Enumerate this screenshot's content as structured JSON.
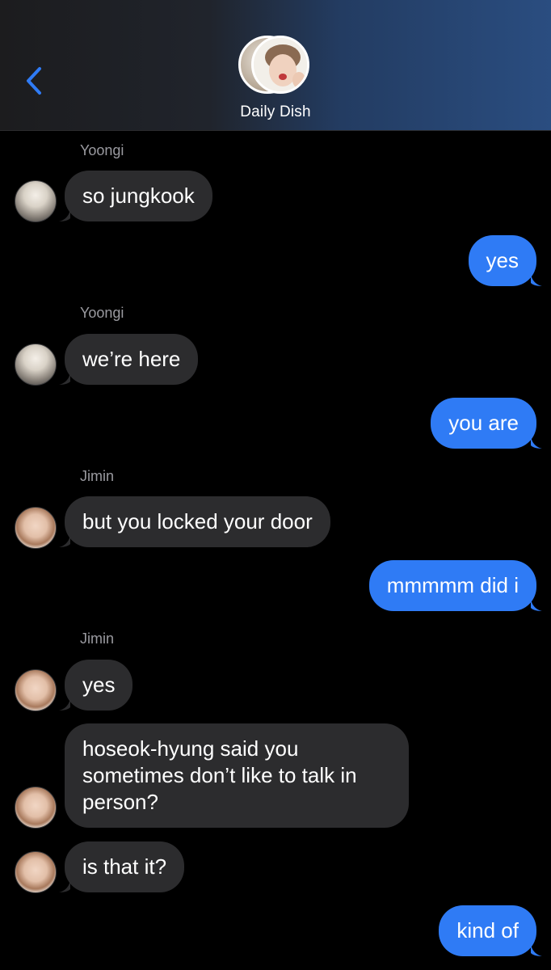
{
  "header": {
    "group_name": "Daily Dish",
    "back_icon": "chevron-left-icon",
    "accent_color": "#2f7bf5"
  },
  "messages": [
    {
      "type": "incoming",
      "sender": "Yoongi",
      "text": "so jungkook"
    },
    {
      "type": "outgoing",
      "text": "yes"
    },
    {
      "type": "incoming",
      "sender": "Yoongi",
      "text": "we’re here"
    },
    {
      "type": "outgoing",
      "text": "you are"
    },
    {
      "type": "incoming",
      "sender": "Jimin",
      "text": "but you locked your door"
    },
    {
      "type": "outgoing",
      "text": "mmmmm did i"
    },
    {
      "type": "incoming",
      "sender": "Jimin",
      "text": "yes"
    },
    {
      "type": "incoming",
      "text": "hoseok-hyung said you sometimes don’t like to talk in person?"
    },
    {
      "type": "incoming",
      "text": "is that it?"
    },
    {
      "type": "outgoing",
      "text": "kind of"
    }
  ],
  "colors": {
    "incoming_bubble": "#2c2c2e",
    "outgoing_bubble": "#2f7bf5",
    "sender_label": "#9a9aa0"
  }
}
